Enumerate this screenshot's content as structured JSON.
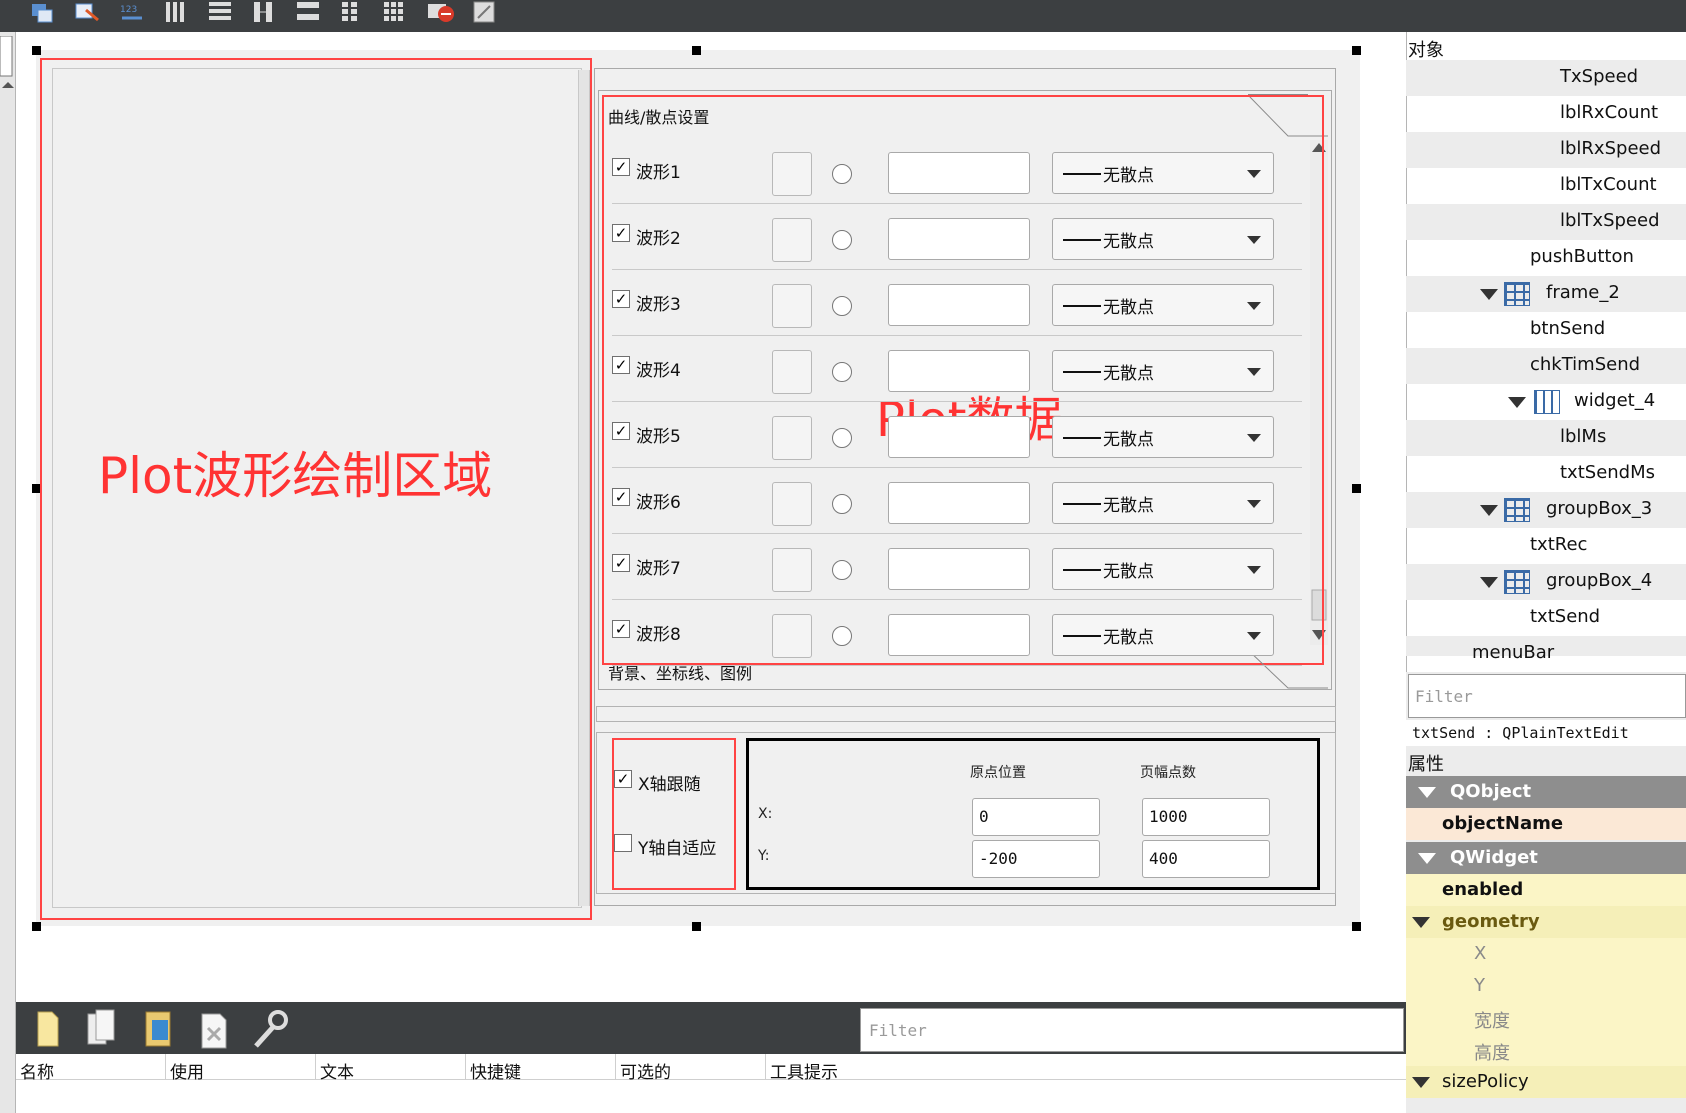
{
  "toolbar": {
    "buttons": [
      "widget-editor-icon",
      "signal-slot-icon",
      "buddy-icon",
      "tab-order-icon",
      "layout-horizontal-icon",
      "layout-vertical-icon",
      "splitter-horizontal-icon",
      "splitter-vertical-icon",
      "layout-form-icon",
      "layout-grid-icon",
      "break-layout-icon",
      "adjust-size-icon"
    ]
  },
  "form": {
    "plot_annotation": "Plot波形绘制区域",
    "data_annotation": "Plot数据",
    "toolbox": {
      "page_title": "曲线/散点设置",
      "page2_title": "背景、坐标线、图例",
      "rows": [
        {
          "label": "波形1",
          "checked": "✓",
          "style": "无散点"
        },
        {
          "label": "波形2",
          "checked": "✓",
          "style": "无散点"
        },
        {
          "label": "波形3",
          "checked": "✓",
          "style": "无散点"
        },
        {
          "label": "波形4",
          "checked": "✓",
          "style": "无散点"
        },
        {
          "label": "波形5",
          "checked": "✓",
          "style": "无散点"
        },
        {
          "label": "波形6",
          "checked": "✓",
          "style": "无散点"
        },
        {
          "label": "波形7",
          "checked": "✓",
          "style": "无散点"
        },
        {
          "label": "波形8",
          "checked": "✓",
          "style": "无散点"
        }
      ]
    },
    "axis": {
      "x_follow_label": "X轴跟随",
      "x_follow_checked": "✓",
      "y_auto_label": "Y轴自适应",
      "y_auto_checked": ""
    },
    "coords": {
      "origin_header": "原点位置",
      "range_header": "页幅点数",
      "x_label": "X:",
      "y_label": "Y:",
      "x_origin": "0",
      "x_range": "1000",
      "y_origin": "-200",
      "y_range": "400"
    }
  },
  "action_editor": {
    "filter_placeholder": "Filter",
    "columns": [
      "名称",
      "使用",
      "文本",
      "快捷键",
      "可选的",
      "工具提示"
    ],
    "buttons": [
      "new-action-icon",
      "copy-action-icon",
      "paste-action-icon",
      "delete-action-icon",
      "configure-icon"
    ]
  },
  "object_inspector": {
    "header": "对象",
    "items": [
      {
        "name": "TxSpeed"
      },
      {
        "name": "lblRxCount"
      },
      {
        "name": "lblRxSpeed"
      },
      {
        "name": "lblTxCount"
      },
      {
        "name": "lblTxSpeed"
      },
      {
        "name": "pushButton"
      },
      {
        "name": "frame_2"
      },
      {
        "name": "btnSend"
      },
      {
        "name": "chkTimSend"
      },
      {
        "name": "widget_4"
      },
      {
        "name": "lblMs"
      },
      {
        "name": "txtSendMs"
      },
      {
        "name": "groupBox_3"
      },
      {
        "name": "txtRec"
      },
      {
        "name": "groupBox_4"
      },
      {
        "name": "txtSend"
      },
      {
        "name": "menuBar"
      }
    ]
  },
  "property_editor": {
    "filter_placeholder": "Filter",
    "object_class": "txtSend : QPlainTextEdit",
    "header": "属性",
    "rows": [
      {
        "name": "QObject"
      },
      {
        "name": "objectName"
      },
      {
        "name": "QWidget"
      },
      {
        "name": "enabled"
      },
      {
        "name": "geometry"
      },
      {
        "name": "X"
      },
      {
        "name": "Y"
      },
      {
        "name": "宽度"
      },
      {
        "name": "高度"
      },
      {
        "name": "sizePolicy"
      }
    ]
  },
  "colors": {
    "annotation_red": "#ff3333",
    "dark_toolbar": "#3c3f41",
    "property_group": "#8e8e8e",
    "property_yellow": "#fbf5c6"
  }
}
